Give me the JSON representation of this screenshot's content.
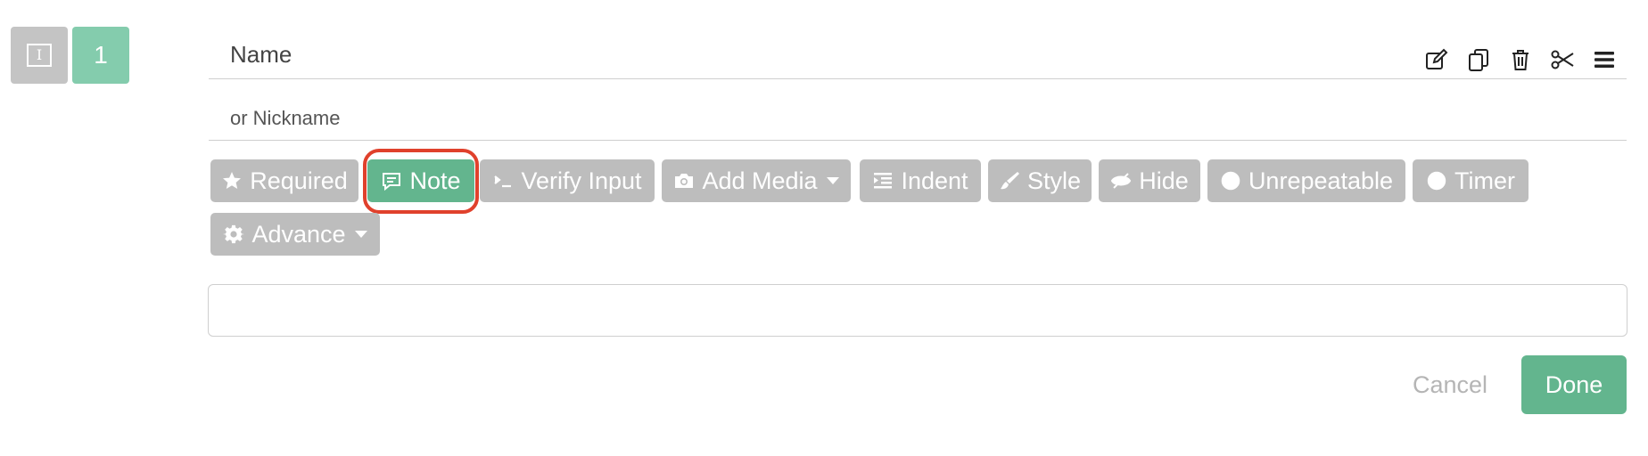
{
  "question": {
    "type_glyph": "I",
    "number": "1",
    "name": "Name",
    "nickname": "or Nickname",
    "answer_value": ""
  },
  "toolbar": {
    "icons": [
      "edit-icon",
      "duplicate-icon",
      "trash-icon",
      "scissors-icon",
      "menu-icon"
    ]
  },
  "options": [
    {
      "id": "required",
      "label": "Required",
      "icon": "star-icon"
    },
    {
      "id": "note",
      "label": "Note",
      "icon": "comment-icon",
      "active": true
    },
    {
      "id": "verify",
      "label": "Verify Input",
      "icon": "terminal-icon"
    },
    {
      "id": "media",
      "label": "Add Media",
      "icon": "camera-icon",
      "dropdown": true
    },
    {
      "id": "indent",
      "label": "Indent",
      "icon": "indent-icon"
    },
    {
      "id": "style",
      "label": "Style",
      "icon": "paintbrush-icon"
    },
    {
      "id": "hide",
      "label": "Hide",
      "icon": "eye-slash-icon"
    },
    {
      "id": "unrepeatable",
      "label": "Unrepeatable",
      "icon": "ban-icon"
    },
    {
      "id": "timer",
      "label": "Timer",
      "icon": "clock-icon"
    },
    {
      "id": "advance",
      "label": "Advance",
      "icon": "gear-icon",
      "dropdown": true
    }
  ],
  "footer": {
    "cancel_label": "Cancel",
    "done_label": "Done"
  },
  "colors": {
    "accent": "#63b58e",
    "accent_light": "#84ccad",
    "button_gray": "#bdbdbd",
    "highlight": "#e0412c"
  }
}
